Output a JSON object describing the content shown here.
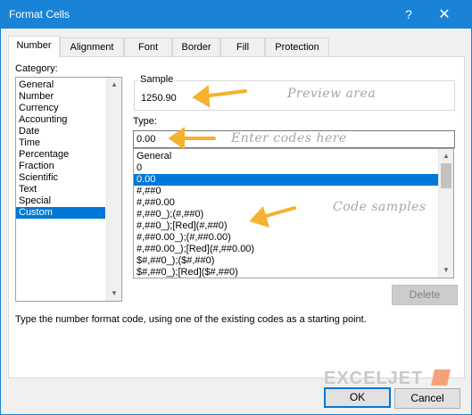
{
  "window": {
    "title": "Format Cells",
    "help_label": "?",
    "close_label": "✕"
  },
  "tabs": [
    {
      "label": "Number",
      "active": true
    },
    {
      "label": "Alignment"
    },
    {
      "label": "Font"
    },
    {
      "label": "Border"
    },
    {
      "label": "Fill"
    },
    {
      "label": "Protection"
    }
  ],
  "category": {
    "label": "Category:",
    "items": [
      "General",
      "Number",
      "Currency",
      "Accounting",
      "Date",
      "Time",
      "Percentage",
      "Fraction",
      "Scientific",
      "Text",
      "Special",
      "Custom"
    ],
    "selected": "Custom"
  },
  "sample": {
    "label": "Sample",
    "value": "1250.90"
  },
  "type": {
    "label": "Type:",
    "value": "0.00"
  },
  "codes": {
    "items": [
      "General",
      "0",
      "0.00",
      "#,##0",
      "#,##0.00",
      "#,##0_);(#,##0)",
      "#,##0_);[Red](#,##0)",
      "#,##0.00_);(#,##0.00)",
      "#,##0.00_);[Red](#,##0.00)",
      "$#,##0_);($#,##0)",
      "$#,##0_);[Red]($#,##0)"
    ],
    "selected": "0.00"
  },
  "delete_label": "Delete",
  "description": "Type the number format code, using one of the existing codes as a starting point.",
  "annotations": {
    "preview": "Preview area",
    "enter": "Enter codes here",
    "samples": "Code samples"
  },
  "logo_text": "EXCELJET",
  "ok_label": "OK",
  "cancel_label": "Cancel",
  "colors": {
    "accent": "#0078d7",
    "arrow": "#f4b22e",
    "titlebar": "#1883d7"
  }
}
